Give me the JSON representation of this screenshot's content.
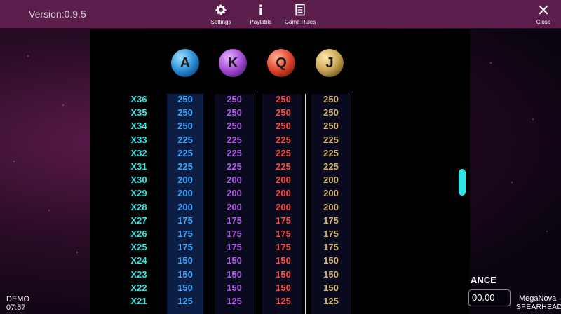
{
  "header": {
    "version": "Version:0.9.5",
    "settings_label": "Settings",
    "paytable_label": "Paytable",
    "rules_label": "Game Rules",
    "close_label": "Close"
  },
  "symbols": [
    {
      "letter": "A",
      "color": "#3aa8ff"
    },
    {
      "letter": "K",
      "color": "#b05ae6"
    },
    {
      "letter": "Q",
      "color": "#ff4a3a"
    },
    {
      "letter": "J",
      "color": "#d9b46a"
    }
  ],
  "paytable": {
    "rows": [
      {
        "mult": "X36",
        "a": "250",
        "k": "250",
        "q": "250",
        "j": "250"
      },
      {
        "mult": "X35",
        "a": "250",
        "k": "250",
        "q": "250",
        "j": "250"
      },
      {
        "mult": "X34",
        "a": "250",
        "k": "250",
        "q": "250",
        "j": "250"
      },
      {
        "mult": "X33",
        "a": "225",
        "k": "225",
        "q": "225",
        "j": "225"
      },
      {
        "mult": "X32",
        "a": "225",
        "k": "225",
        "q": "225",
        "j": "225"
      },
      {
        "mult": "X31",
        "a": "225",
        "k": "225",
        "q": "225",
        "j": "225"
      },
      {
        "mult": "X30",
        "a": "200",
        "k": "200",
        "q": "200",
        "j": "200"
      },
      {
        "mult": "X29",
        "a": "200",
        "k": "200",
        "q": "200",
        "j": "200"
      },
      {
        "mult": "X28",
        "a": "200",
        "k": "200",
        "q": "200",
        "j": "200"
      },
      {
        "mult": "X27",
        "a": "175",
        "k": "175",
        "q": "175",
        "j": "175"
      },
      {
        "mult": "X26",
        "a": "175",
        "k": "175",
        "q": "175",
        "j": "175"
      },
      {
        "mult": "X25",
        "a": "175",
        "k": "175",
        "q": "175",
        "j": "175"
      },
      {
        "mult": "X24",
        "a": "150",
        "k": "150",
        "q": "150",
        "j": "150"
      },
      {
        "mult": "X23",
        "a": "150",
        "k": "150",
        "q": "150",
        "j": "150"
      },
      {
        "mult": "X22",
        "a": "150",
        "k": "150",
        "q": "150",
        "j": "150"
      },
      {
        "mult": "X21",
        "a": "125",
        "k": "125",
        "q": "125",
        "j": "125"
      }
    ]
  },
  "footer": {
    "demo": "DEMO",
    "time": "07:57",
    "balance_label": "ANCE",
    "balance_value": "00.00",
    "brand_game": "MegaNova",
    "brand_company": "SPEARHEAD"
  }
}
